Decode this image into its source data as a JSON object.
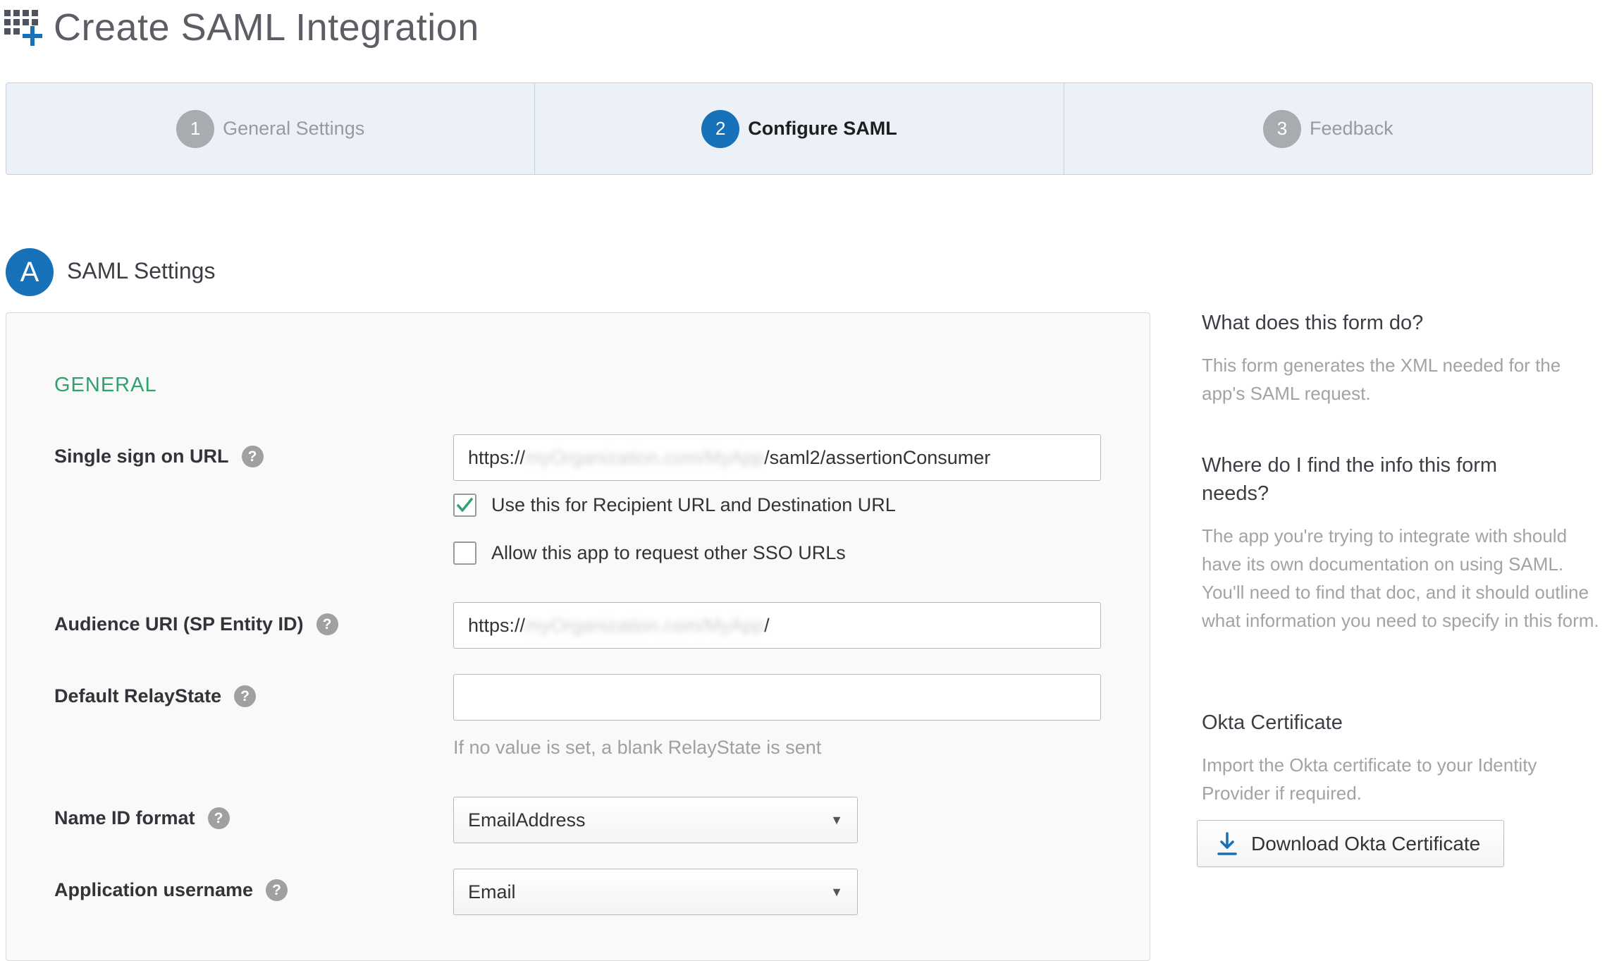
{
  "header": {
    "title": "Create SAML Integration",
    "icon": "app-grid-plus-icon"
  },
  "wizard": {
    "steps": [
      {
        "num": "1",
        "label": "General Settings",
        "state": "inactive"
      },
      {
        "num": "2",
        "label": "Configure SAML",
        "state": "active"
      },
      {
        "num": "3",
        "label": "Feedback",
        "state": "inactive"
      }
    ]
  },
  "section": {
    "badge": "A",
    "title": "SAML Settings"
  },
  "form": {
    "group_heading": "GENERAL",
    "sso_url": {
      "label": "Single sign on URL",
      "value_prefix": "https://",
      "value_redacted": "myOrganization.com/MyApp",
      "value_suffix": "/saml2/assertionConsumer"
    },
    "use_recipient": {
      "label": "Use this for Recipient URL and Destination URL",
      "checked": true
    },
    "allow_other_sso": {
      "label": "Allow this app to request other SSO URLs",
      "checked": false
    },
    "audience_uri": {
      "label": "Audience URI (SP Entity ID)",
      "value_prefix": "https://",
      "value_redacted": "myOrganization.com/MyApp",
      "value_suffix": "/"
    },
    "relay_state": {
      "label": "Default RelayState",
      "value": "",
      "hint": "If no value is set, a blank RelayState is sent"
    },
    "name_id_format": {
      "label": "Name ID format",
      "selected": "EmailAddress"
    },
    "app_username": {
      "label": "Application username",
      "selected": "Email"
    },
    "help_glyph": "?",
    "caret_glyph": "▼"
  },
  "sidebar": {
    "q1": {
      "title": "What does this form do?",
      "body": "This form generates the XML needed for the app's SAML request."
    },
    "q2": {
      "title": "Where do I find the info this form needs?",
      "body": "The app you're trying to integrate with should have its own documentation on using SAML. You'll need to find that doc, and it should outline what information you need to specify in this form."
    },
    "cert": {
      "title": "Okta Certificate",
      "body": "Import the Okta certificate to your Identity Provider if required.",
      "button_label": "Download Okta Certificate"
    }
  },
  "colors": {
    "accent": "#1671b8",
    "green": "#2ea36e",
    "wizard_bg": "#ebf1f7"
  }
}
